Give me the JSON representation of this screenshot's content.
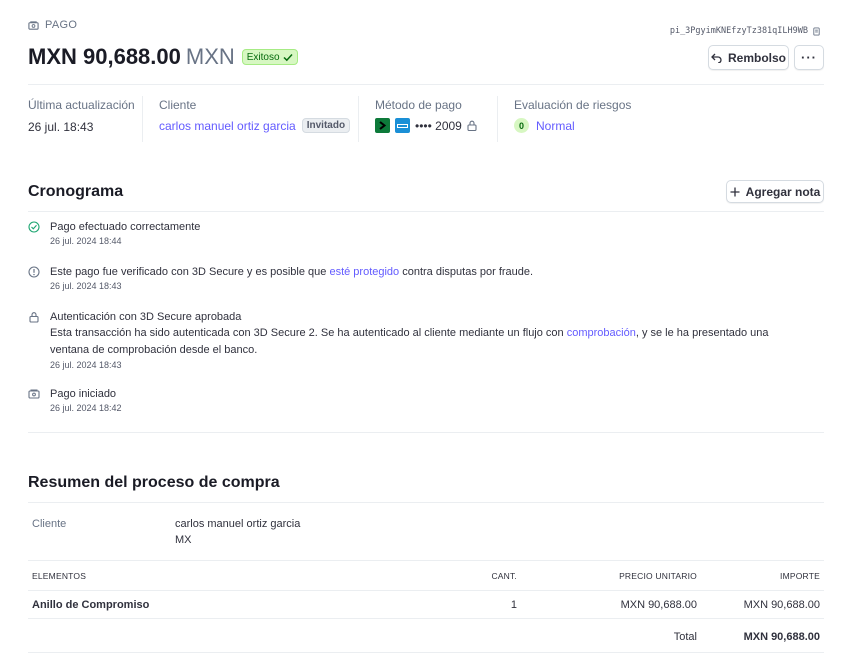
{
  "header": {
    "section_label": "PAGO",
    "payment_id": "pi_3PgyimKNEfzyTz381qILH9WB",
    "amount": "MXN 90,688.00",
    "currency": "MXN",
    "status": "Exitoso",
    "refund_label": "Rembolso",
    "more_label": "···"
  },
  "summary": {
    "last_update": {
      "label": "Última actualización",
      "value": "26 jul. 18:43"
    },
    "customer": {
      "label": "Cliente",
      "value": "carlos manuel ortiz garcia",
      "badge": "Invitado"
    },
    "payment_method": {
      "label": "Método de pago",
      "value": "•••• 2009"
    },
    "risk": {
      "label": "Evaluación de riesgos",
      "score": "0",
      "value": "Normal"
    }
  },
  "timeline": {
    "title": "Cronograma",
    "add_note_label": "Agregar nota",
    "events": [
      {
        "title": "Pago efectuado correctamente",
        "time": "26 jul. 2024 18:44"
      },
      {
        "title_pre": "Este pago fue verificado con 3D Secure y es posible que ",
        "title_link": "esté protegido",
        "title_post": " contra disputas por fraude.",
        "time": "26 jul. 2024 18:43"
      },
      {
        "title": "Autenticación con 3D Secure aprobada",
        "body_pre": "Esta transacción ha sido autenticada con 3D Secure 2. Se ha autenticado al cliente mediante un flujo con ",
        "body_link": "comprobación",
        "body_post": ", y se le ha presentado una ventana de comprobación desde el banco.",
        "time": "26 jul. 2024 18:43"
      },
      {
        "title": "Pago iniciado",
        "time": "26 jul. 2024 18:42"
      }
    ]
  },
  "purchase": {
    "title": "Resumen del proceso de compra",
    "customer_label": "Cliente",
    "customer_name": "carlos manuel ortiz garcia",
    "customer_country": "MX",
    "columns": [
      "ELEMENTOS",
      "CANT.",
      "PRECIO UNITARIO",
      "IMPORTE"
    ],
    "items": [
      {
        "name": "Anillo de Compromiso",
        "qty": "1",
        "unit_price": "MXN 90,688.00",
        "amount": "MXN 90,688.00"
      }
    ],
    "total_label": "Total",
    "total_value": "MXN 90,688.00"
  },
  "colors": {
    "accent": "#635bff",
    "success": "#05690d",
    "success_bg": "#d7f7c2",
    "text": "#30313d",
    "muted": "#687385"
  }
}
